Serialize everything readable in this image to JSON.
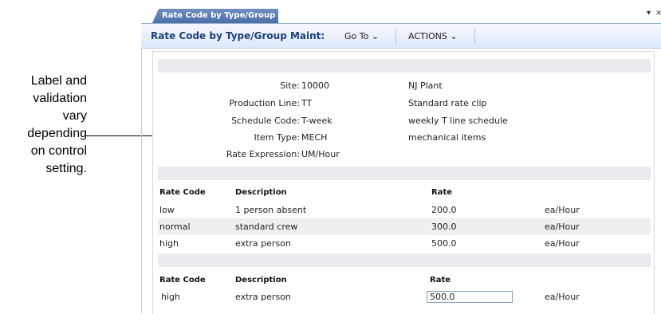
{
  "callout": {
    "lines": [
      "Label and",
      "validation",
      "vary",
      "depending",
      "on control",
      "setting."
    ]
  },
  "window": {
    "tab_label": "Rate Code by Type/Group M...",
    "controls": {
      "menu": "▾",
      "close": "×"
    }
  },
  "toolbar": {
    "title": "Rate Code by Type/Group Maint:",
    "goto_label": "Go To ⌄",
    "actions_label": "ACTIONS ⌄"
  },
  "header": {
    "fields": [
      {
        "label": "Site:",
        "value": "10000",
        "desc": "NJ Plant"
      },
      {
        "label": "Production Line:",
        "value": "TT",
        "desc": "Standard rate clip"
      },
      {
        "label": "Schedule Code:",
        "value": "T-week",
        "desc": "weekly T line schedule"
      },
      {
        "label": "Item Type:",
        "value": "MECH",
        "desc": "mechanical items"
      },
      {
        "label": "Rate Expression:",
        "value": "UM/Hour",
        "desc": ""
      }
    ]
  },
  "grid": {
    "columns": [
      "Rate Code",
      "Description",
      "Rate"
    ],
    "rows": [
      {
        "code": "low",
        "description": "1 person absent",
        "rate": "200.0",
        "unit": "ea/Hour"
      },
      {
        "code": "normal",
        "description": "standard crew",
        "rate": "300.0",
        "unit": "ea/Hour"
      },
      {
        "code": "high",
        "description": "extra person",
        "rate": "500.0",
        "unit": "ea/Hour"
      }
    ]
  },
  "detail": {
    "columns": [
      "Rate Code",
      "Description",
      "Rate"
    ],
    "code": "high",
    "description": "extra person",
    "rate": "500.0",
    "unit": "ea/Hour"
  }
}
